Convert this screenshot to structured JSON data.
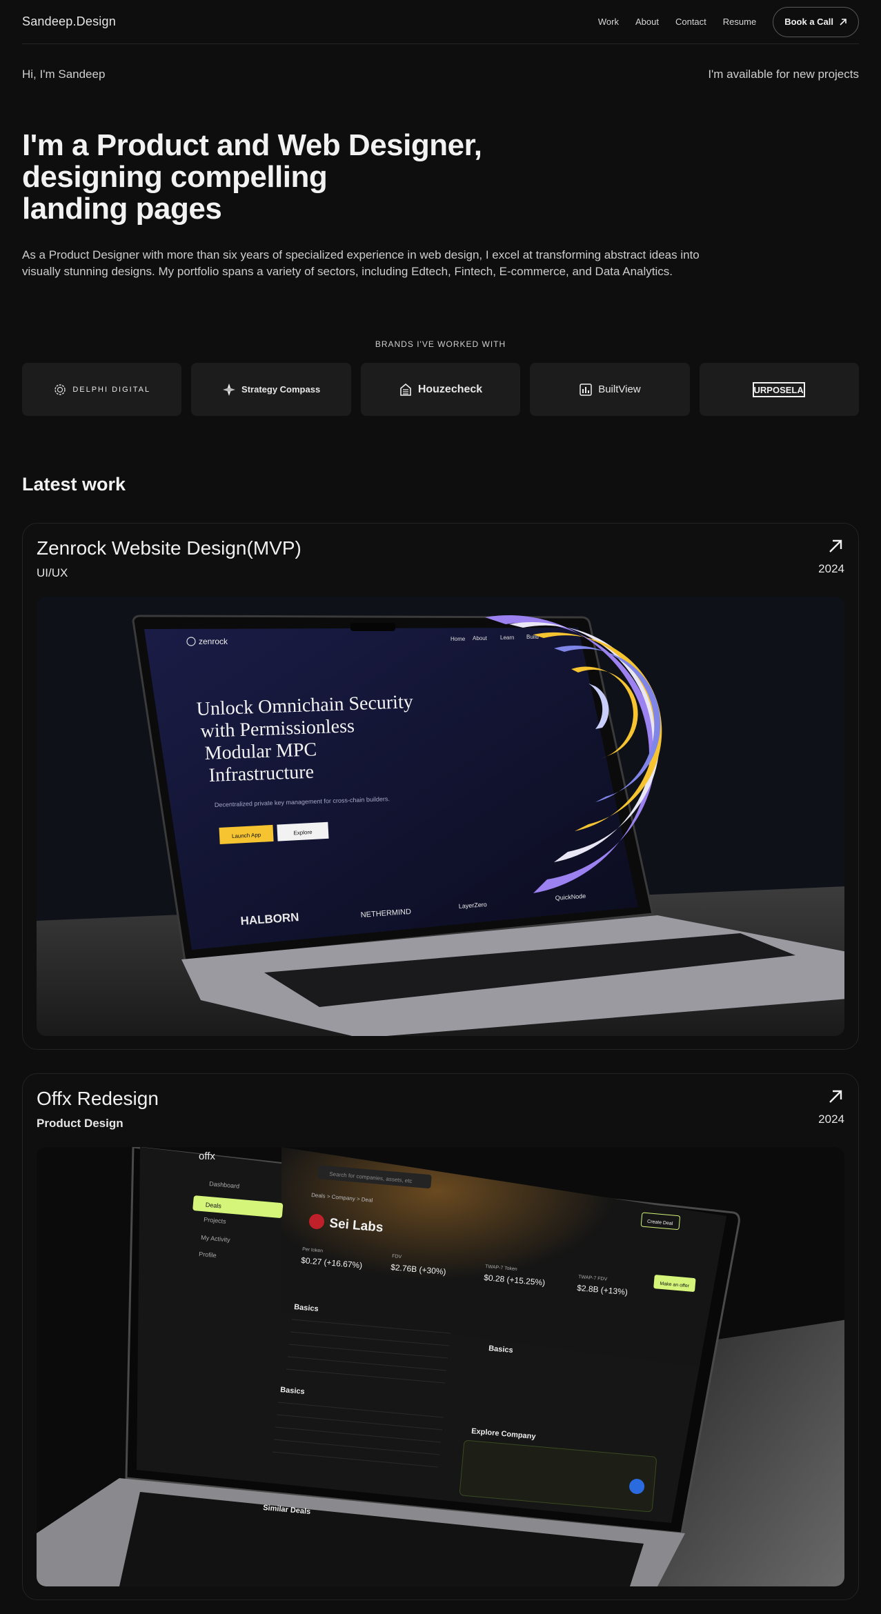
{
  "nav": {
    "logo": "Sandeep.Design",
    "links": [
      "Work",
      "About",
      "Contact",
      "Resume"
    ],
    "cta": "Book a Call"
  },
  "hero": {
    "greeting": "Hi, I'm Sandeep",
    "availability": "I'm available for new projects",
    "title_line1": "I'm a Product and Web Designer,",
    "title_line2": "designing compelling",
    "title_line3": "landing pages",
    "description": "As a Product Designer with more than six years of specialized experience in web design, I excel at transforming abstract ideas into visually stunning designs. My portfolio spans a variety of sectors, including Edtech, Fintech, E-commerce, and Data Analytics."
  },
  "brands": {
    "heading": "BRANDS I'VE WORKED WITH",
    "items": [
      {
        "name": "DELPHI DIGITAL",
        "icon": "delphi-icon"
      },
      {
        "name": "Strategy Compass",
        "icon": "compass-icon"
      },
      {
        "name": "Houzecheck",
        "icon": "house-icon"
      },
      {
        "name": "BuiltView",
        "icon": "builtview-icon"
      },
      {
        "name": "PURPOSELAB",
        "icon": "purposelab-logo"
      }
    ]
  },
  "latest": {
    "heading": "Latest work",
    "projects": [
      {
        "title": "Zenrock Website Design(MVP)",
        "category": "UI/UX",
        "year": "2024",
        "screen": {
          "brand": "zenrock",
          "menu": [
            "Home",
            "About",
            "Learn",
            "Build"
          ],
          "headline_1": "Unlock Omnichain Security",
          "headline_2": "with Permissionless",
          "headline_3": "Modular MPC",
          "headline_4": "Infrastructure",
          "sub": "Decentralized private key management for cross-chain builders.",
          "primary": "Launch App",
          "secondary": "Explore",
          "partners": [
            "HALBORN",
            "NETHERMIND",
            "LayerZero",
            "QuickNode"
          ]
        }
      },
      {
        "title": "Offx Redesign",
        "category": "Product Design",
        "year": "2024",
        "screen": {
          "brand": "offx",
          "search": "Search for companies, assets, etc",
          "nav": [
            "Dashboard",
            "Deals",
            "Projects",
            "My Activity",
            "Profile"
          ],
          "crumb": "Deals > Company > Deal",
          "company": "Sei Labs",
          "create": "Create Deal",
          "offer": "Make an offer",
          "stats": [
            {
              "label": "Per token",
              "value": "$0.27 (+16.67%)"
            },
            {
              "label": "FDV",
              "value": "$2.76B (+30%)"
            },
            {
              "label": "TWAP-7 Token",
              "value": "$0.28 (+15.25%)"
            },
            {
              "label": "TWAP-7 FDV",
              "value": "$2.8B (+13%)"
            }
          ],
          "basics": "Basics",
          "explore": "Explore Company",
          "similar": "Similar Deals"
        }
      }
    ]
  },
  "colors": {
    "background": "#0e0e0e",
    "card": "#1c1c1c",
    "zenrock_yellow": "#f5c430",
    "zenrock_purple": "#9b82f0",
    "offx_green": "#d4f57a"
  }
}
